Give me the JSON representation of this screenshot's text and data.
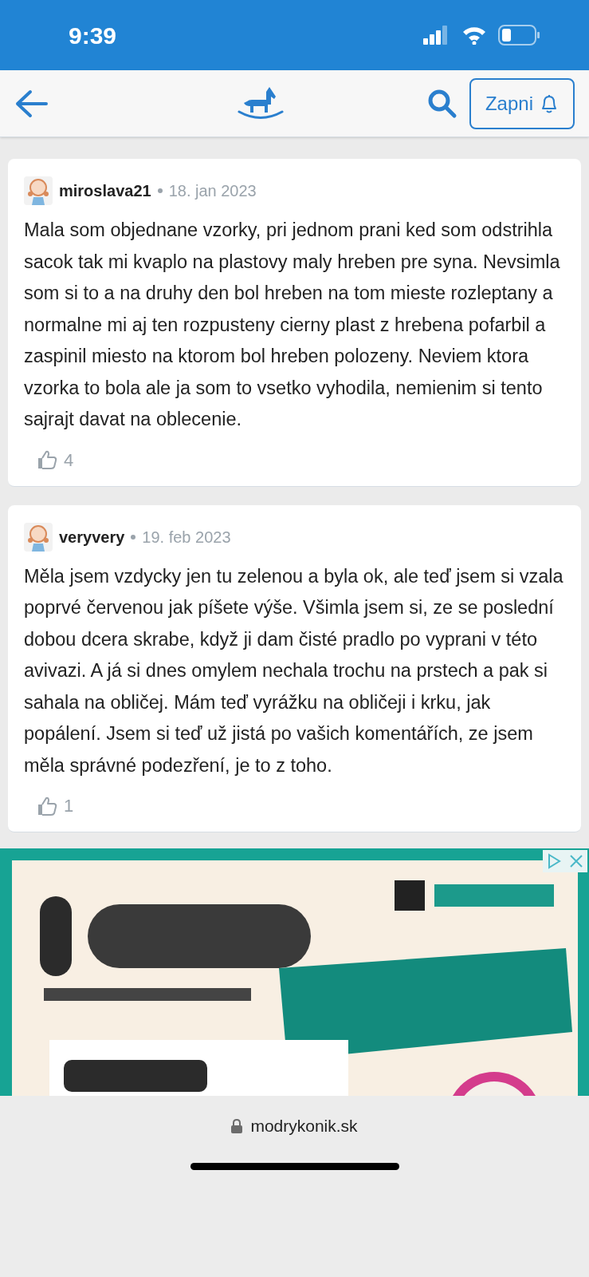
{
  "status_bar": {
    "time": "9:39"
  },
  "nav": {
    "button": "Zapni"
  },
  "comments": [
    {
      "user": "miroslava21",
      "date": "18. jan 2023",
      "text": "Mala som objednane vzorky, pri jednom prani ked som odstrihla sacok tak mi kvaplo na plastovy maly hreben pre syna. Nevsimla som si to a na druhy den bol hreben na tom mieste rozleptany a normalne mi aj ten rozpusteny cierny plast z hrebena pofarbil a zaspinil miesto na ktorom bol hreben polozeny. Neviem ktora vzorka to bola ale ja som to vsetko vyhodila, nemienim si tento sajrajt davat na oblecenie.",
      "likes": "4"
    },
    {
      "user": "veryvery",
      "date": "19. feb 2023",
      "text": "Měla jsem vzdycky jen tu zelenou a byla ok, ale teď jsem si vzala poprvé červenou jak píšete výše. Všimla jsem si, ze se poslední dobou dcera skrabe, když ji dam čisté pradlo po vyprani v této avivazi. A já si dnes omylem nechala trochu na prstech a pak si sahala na obličej. Mám teď vyrážku na obličeji i krku, jak popálení. Jsem si teď už jistá po vašich komentářích, ze jsem měla správné podezření, je to z toho.",
      "likes": "1"
    }
  ],
  "browser_bar": {
    "url": "modrykonik.sk"
  }
}
